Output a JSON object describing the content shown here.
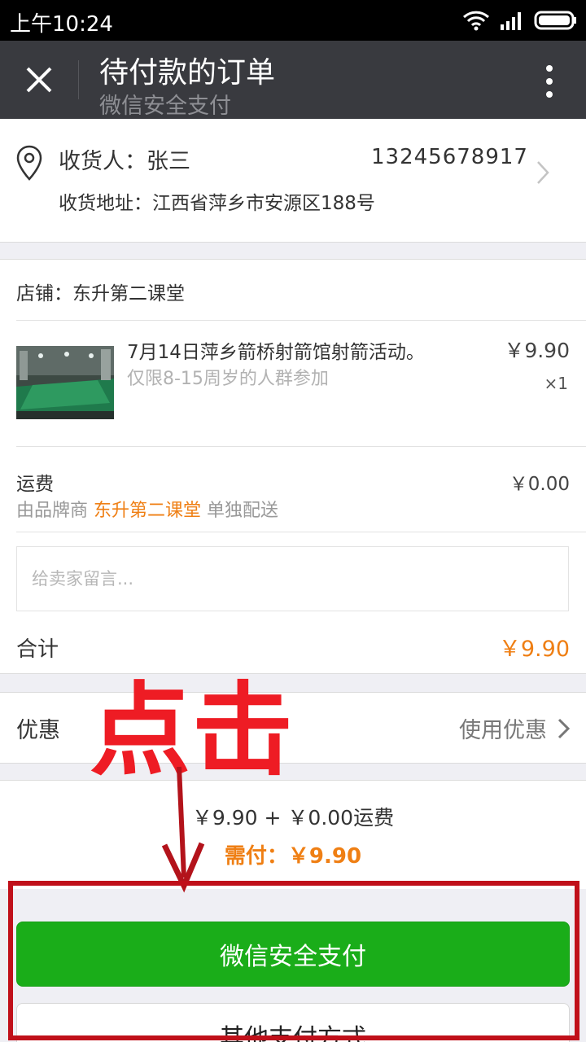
{
  "status_bar": {
    "time": "上午10:24"
  },
  "title_bar": {
    "title": "待付款的订单",
    "subtitle": "微信安全支付"
  },
  "address": {
    "receiver": "收货人：张三",
    "phone": "13245678917",
    "address": "收货地址：江西省萍乡市安源区188号"
  },
  "order": {
    "shop": "店铺：东升第二课堂",
    "product": {
      "title": "7月14日萍乡箭桥射箭馆射箭活动。",
      "desc": "仅限8-15周岁的人群参加",
      "price": "￥9.90",
      "qty": "×1"
    },
    "shipping": {
      "label": "运费",
      "fee": "￥0.00",
      "desc_prefix": "由品牌商",
      "brand": "东升第二课堂",
      "desc_suffix": "单独配送"
    },
    "message_placeholder": "给卖家留言...",
    "total_label": "合计",
    "total_value": "￥9.90"
  },
  "discount": {
    "label": "优惠",
    "action": "使用优惠"
  },
  "summary": {
    "line": "￥9.90 + ￥0.00运费",
    "need_pay": "需付：￥9.90"
  },
  "buttons": {
    "wechat_pay": "微信安全支付",
    "other_pay": "其他支付方式"
  },
  "annotation": {
    "text": "点击"
  },
  "colors": {
    "accent_orange": "#ef7f14",
    "wechat_green": "#1aad19",
    "annotation_red": "#ee1c24",
    "titlebar": "#393a3f"
  }
}
